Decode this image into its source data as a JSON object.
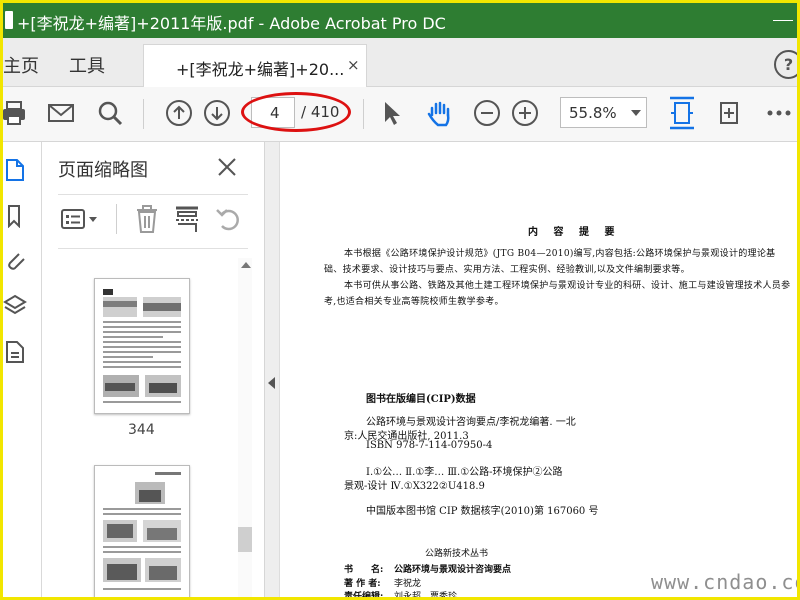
{
  "window": {
    "title": "+[李祝龙+编著]+2011年版.pdf - Adobe Acrobat Pro DC"
  },
  "tabs": {
    "home": "主页",
    "tools": "工具",
    "document": "+[李祝龙+编著]+20...",
    "close": "×",
    "help": "?"
  },
  "toolbar": {
    "page_current": "4",
    "page_total": "/ 410",
    "zoom": "55.8%"
  },
  "panel": {
    "title": "页面缩略图",
    "thumbnail_label": "344"
  },
  "document": {
    "heading": "内 容 提 要",
    "para1": "本书根据《公路环境保护设计规范》(JTG B04—2010)编写,内容包括:公路环境保护与景观设计的理论基础、技术要求、设计技巧与要点、实用方法、工程实例、经验教训,以及文件编制要求等。",
    "para2": "本书可供从事公路、铁路及其他土建工程环境保护与景观设计专业的科研、设计、施工与建设管理技术人员参考,也适合相关专业高等院校师生教学参考。",
    "cip_title": "图书在版编目(CIP)数据",
    "cip_line1": "公路环境与景观设计咨询要点/李祝龙编著. 一北",
    "cip_line2": "京:人民交通出版社, 2011.3",
    "cip_line3": "ISBN 978-7-114-07950-4",
    "cip_class1": "Ⅰ.①公… Ⅱ.①李… Ⅲ.①公路-环境保护②公路",
    "cip_class2": "景观-设计 Ⅳ.①X322②U418.9",
    "cip_number": "中国版本图书馆 CIP 数据核字(2010)第 167060 号",
    "series": "公路新技术丛书",
    "book_label": "书　　名:",
    "book_value": "公路环境与景观设计咨询要点",
    "author_label": "著 作 者:",
    "author_value": "李祝龙",
    "editor_label": "责任编辑:",
    "editor_value": "刘永超　贾秀珍"
  },
  "watermark": "www.cndao.com",
  "colors": {
    "title_bar": "#2e7d32",
    "highlight_ring": "#dd1111",
    "accent_blue": "#1473e6",
    "frame": "#f2e600"
  },
  "icons": {
    "toolbar": [
      "print-icon",
      "email-icon",
      "search-icon",
      "prev-page-icon",
      "next-page-icon",
      "select-cursor-icon",
      "hand-tool-icon",
      "zoom-out-icon",
      "zoom-in-icon",
      "fit-page-icon",
      "rotate-view-icon",
      "more-icon"
    ],
    "left_nav": [
      "page-thumbnails-icon",
      "bookmarks-icon",
      "attachments-icon",
      "layers-icon",
      "document-icon"
    ],
    "panel": [
      "options-menu-icon",
      "delete-icon",
      "insert-page-icon",
      "undo-icon"
    ]
  }
}
